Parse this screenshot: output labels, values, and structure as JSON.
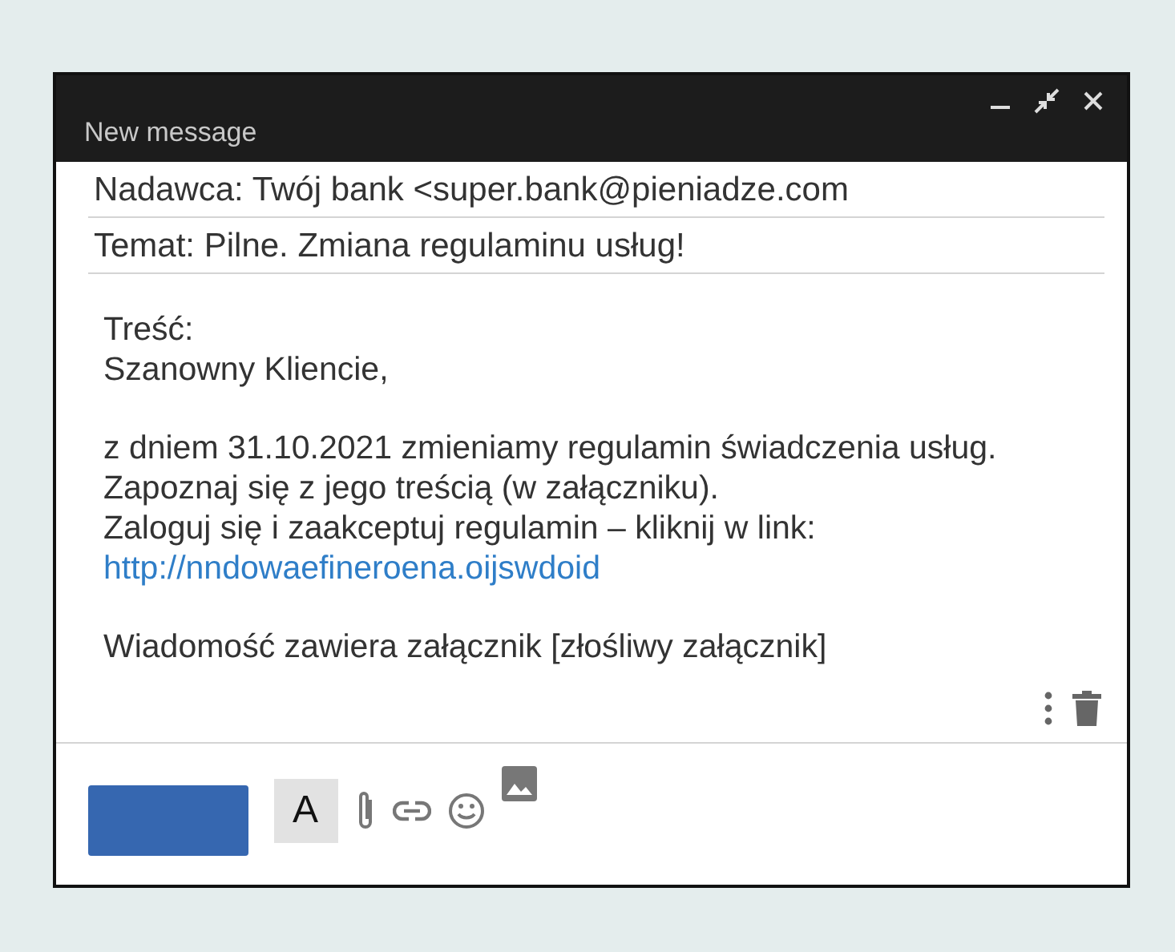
{
  "window": {
    "title": "New message"
  },
  "fields": [
    {
      "text": "Nadawca: Twój bank <super.bank@pieniadze.com"
    },
    {
      "text": "Temat: Pilne. Zmiana regulaminu usług!"
    }
  ],
  "body": [
    [
      {
        "kind": "text",
        "text": "Treść:"
      },
      {
        "kind": "text",
        "text": "Szanowny Kliencie,"
      }
    ],
    [
      {
        "kind": "text",
        "text": "z dniem 31.10.2021 zmieniamy regulamin świadczenia usług."
      },
      {
        "kind": "text",
        "text": "Zapoznaj się z jego treścią (w załączniku)."
      },
      {
        "kind": "text",
        "text": "Zaloguj się i zaakceptuj regulamin – kliknij w link:"
      },
      {
        "kind": "link",
        "text": "http://nndowaefineroena.oijswdoid"
      }
    ],
    [
      {
        "kind": "text",
        "text": "Wiadomość zawiera załącznik [złośliwy załącznik]"
      }
    ]
  ],
  "toolbar": {
    "format_button": "A"
  }
}
